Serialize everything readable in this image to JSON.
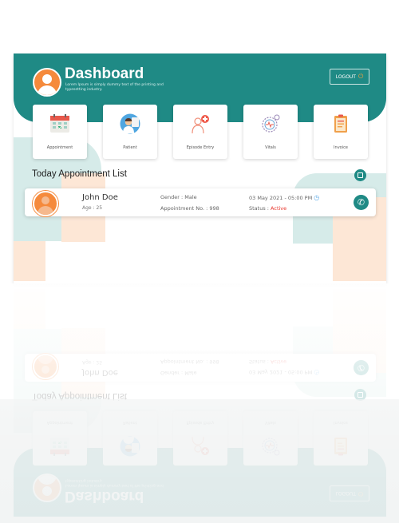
{
  "header": {
    "title": "Dashboard",
    "subtitle": "Lorem Ipsum is simply dummy text of the printing and typesetting industry.",
    "logout_label": "LOGOUT"
  },
  "icons": {
    "avatar": "user-avatar-icon",
    "logout": "power-icon",
    "appointment": "calendar-icon",
    "patient": "doctor-icon",
    "episode": "medical-plus-icon",
    "vitals": "vitals-monitor-icon",
    "invoice": "clipboard-icon",
    "list": "calendar-badge-icon",
    "time": "clock-icon",
    "call": "phone-icon"
  },
  "colors": {
    "primary": "#1f8a85",
    "accent": "#f58a3c",
    "status_active": "#e8352b"
  },
  "cards": [
    {
      "label": "Appointment"
    },
    {
      "label": "Patient"
    },
    {
      "label": "Episode Entry"
    },
    {
      "label": "Vitals"
    },
    {
      "label": "Invoice"
    }
  ],
  "appointments": {
    "title": "Today Appointment List",
    "items": [
      {
        "name": "John Doe",
        "age": "Age : 25",
        "gender": "Gender  : Male",
        "appointment_no": "Appointment No. : 998",
        "datetime": "03 May 2021  -  05:00 PM",
        "status_label": "Status : ",
        "status_value": "Active"
      }
    ]
  }
}
